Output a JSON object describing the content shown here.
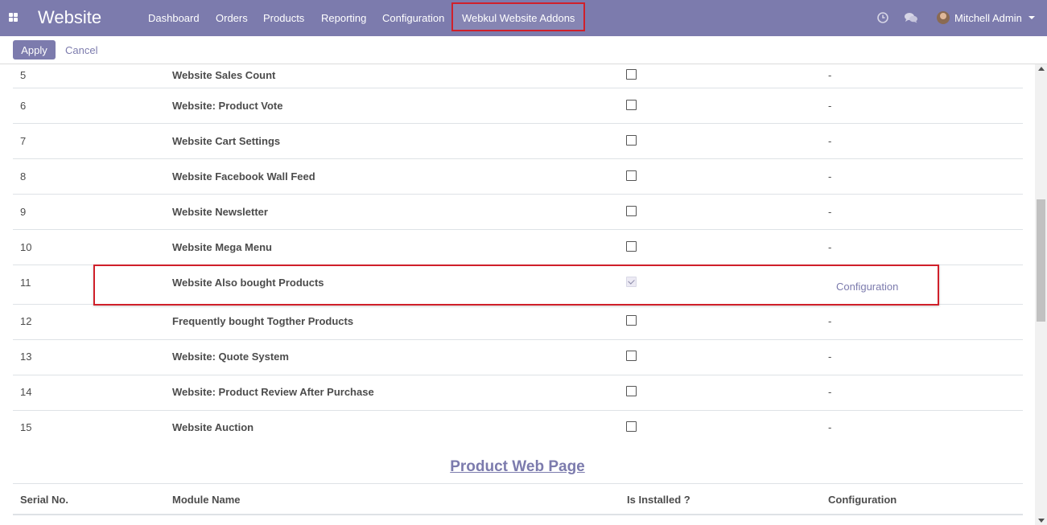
{
  "navbar": {
    "app_title": "Website",
    "menu": [
      "Dashboard",
      "Orders",
      "Products",
      "Reporting",
      "Configuration",
      "Webkul Website Addons"
    ],
    "icons": [
      "apps-grid-icon",
      "clock-icon",
      "chat-icon"
    ],
    "user_name": "Mitchell Admin",
    "bg_color": "#7c7bad"
  },
  "control_panel": {
    "apply_label": "Apply",
    "cancel_label": "Cancel"
  },
  "rows": [
    {
      "serial": "5",
      "name": "Website Sales Count",
      "installed": false,
      "config": "-"
    },
    {
      "serial": "6",
      "name": "Website: Product Vote",
      "installed": false,
      "config": "-"
    },
    {
      "serial": "7",
      "name": "Website Cart Settings",
      "installed": false,
      "config": "-"
    },
    {
      "serial": "8",
      "name": "Website Facebook Wall Feed",
      "installed": false,
      "config": "-"
    },
    {
      "serial": "9",
      "name": "Website Newsletter",
      "installed": false,
      "config": "-"
    },
    {
      "serial": "10",
      "name": "Website Mega Menu",
      "installed": false,
      "config": "-"
    },
    {
      "serial": "11",
      "name": "Website Also bought Products",
      "installed": true,
      "config": "Configuration"
    },
    {
      "serial": "12",
      "name": "Frequently bought Togther Products",
      "installed": false,
      "config": "-"
    },
    {
      "serial": "13",
      "name": "Website: Quote System",
      "installed": false,
      "config": "-"
    },
    {
      "serial": "14",
      "name": "Website: Product Review After Purchase",
      "installed": false,
      "config": "-"
    },
    {
      "serial": "15",
      "name": "Website Auction",
      "installed": false,
      "config": "-"
    }
  ],
  "section": {
    "title": "Product Web Page",
    "headers": {
      "serial": "Serial No.",
      "module": "Module Name",
      "installed": "Is Installed ?",
      "config": "Configuration"
    }
  }
}
